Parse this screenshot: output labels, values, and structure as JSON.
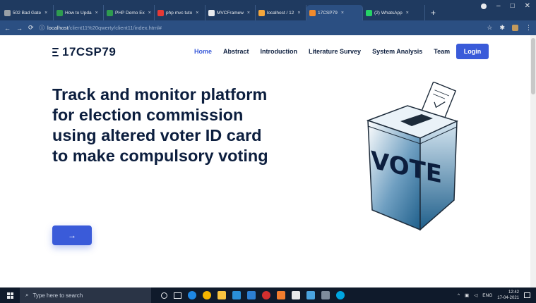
{
  "browser": {
    "tabs": [
      {
        "label": "502 Bad Gate",
        "favicon_color": "#9aa0a6",
        "active": false
      },
      {
        "label": "How to Upda",
        "favicon_color": "#2e9b4f",
        "active": false
      },
      {
        "label": "PHP Demo Ex",
        "favicon_color": "#2e9b4f",
        "active": false
      },
      {
        "label": "php mvc tuto",
        "favicon_color": "#e53935",
        "active": false
      },
      {
        "label": "MVCFramew",
        "favicon_color": "#e8eaed",
        "active": false
      },
      {
        "label": "localhost / 12",
        "favicon_color": "#f4a63b",
        "active": false
      },
      {
        "label": "17CSP79",
        "favicon_color": "#f08a2c",
        "active": true
      },
      {
        "label": "(2) WhatsApp",
        "favicon_color": "#25d366",
        "active": false
      }
    ],
    "close_glyph": "×",
    "newtab_glyph": "+",
    "window_controls": {
      "minimize": "–",
      "maximize": "□",
      "close": "✕"
    },
    "url": {
      "host": "localhost",
      "path": "/client11%20qwerty/client11/index.html#"
    }
  },
  "page": {
    "brand": "17CSP79",
    "nav": [
      {
        "label": "Home",
        "active": true
      },
      {
        "label": "Abstract",
        "active": false
      },
      {
        "label": "Introduction",
        "active": false
      },
      {
        "label": "Literature Survey",
        "active": false
      },
      {
        "label": "System Analysis",
        "active": false
      },
      {
        "label": "Team",
        "active": false
      }
    ],
    "login_label": "Login",
    "hero_title": "Track and monitor platform for election commission using altered voter ID card to make compulsory voting",
    "cta_label": "→",
    "illustration": {
      "ballot_text": "VOTE",
      "icon": "ballot-box-illustration",
      "accent": "#1f5f8b"
    },
    "accent_color": "#3a5bd9",
    "text_color": "#0c1e3e"
  },
  "taskbar": {
    "search_placeholder": "Type here to search",
    "language": "ENG",
    "time": "12:42",
    "date": "17-04-2021"
  }
}
